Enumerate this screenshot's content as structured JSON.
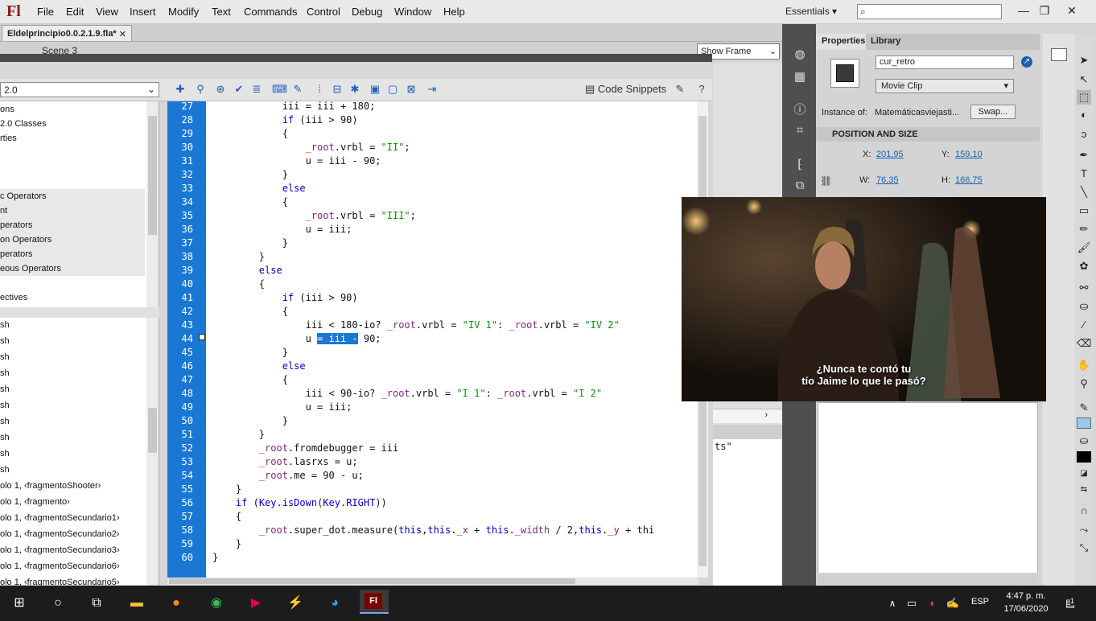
{
  "app": {
    "logo": "Fl",
    "menu": [
      "File",
      "Edit",
      "View",
      "Insert",
      "Modify",
      "Text",
      "Commands",
      "Control",
      "Debug",
      "Window",
      "Help"
    ],
    "workspace": "Essentials",
    "search_placeholder": ""
  },
  "window_controls": {
    "minimize": "—",
    "restore": "❐",
    "close": "✕"
  },
  "document": {
    "tab_label": "Eldelprincipio0.0.2.1.9.fla*",
    "tab_close": "✕",
    "scene": "Scene 3",
    "view_select": "Show Frame"
  },
  "actions": {
    "version": "2.0",
    "code_snippets": "Code Snippets"
  },
  "left_tree": [
    "ons",
    "2.0 Classes",
    "rties",
    "",
    "c Operators",
    "nt",
    "perators",
    "on Operators",
    "perators",
    "eous Operators",
    "",
    "ectives"
  ],
  "left_tree2": [
    "sh",
    "sh",
    "sh",
    "sh",
    "sh",
    "sh",
    "sh",
    "sh",
    "sh",
    "sh",
    "olo 1, ‹fragmentoShooter›",
    "olo 1, ‹fragmento›",
    "olo 1, ‹fragmentoSecundario1›",
    "olo 1, ‹fragmentoSecundario2›",
    "olo 1, ‹fragmentoSecundario3›",
    "olo 1, ‹fragmentoSecundario6›",
    "olo 1, ‹fragmentoSecundario5›"
  ],
  "code": {
    "line_numbers": [
      "27",
      "28",
      "29",
      "30",
      "31",
      "32",
      "33",
      "34",
      "35",
      "36",
      "37",
      "38",
      "39",
      "40",
      "41",
      "42",
      "43",
      "44",
      "45",
      "46",
      "47",
      "48",
      "49",
      "50",
      "51",
      "52",
      "53",
      "54",
      "55",
      "56",
      "57",
      "58",
      "59",
      "60"
    ],
    "lines": [
      "            iii = iii + 180;",
      "            if (iii > 90)",
      "            {",
      "                _root.vrbl = \"II\";",
      "                u = iii - 90;",
      "            }",
      "            else",
      "            {",
      "                _root.vrbl = \"III\";",
      "                u = iii;",
      "            }",
      "        }",
      "        else",
      "        {",
      "            if (iii > 90)",
      "            {",
      "                iii < 180-io? _root.vrbl = \"IV 1\": _root.vrbl = \"IV 2\"",
      "                u = iii - 90;",
      "            }",
      "            else",
      "            {",
      "                iii < 90-io? _root.vrbl = \"I 1\": _root.vrbl = \"I 2\"",
      "                u = iii;",
      "            }",
      "        }",
      "        _root.fromdebugger = iii",
      "        _root.lasrxs = u;",
      "        _root.me = 90 - u;",
      "    }",
      "    if (Key.isDown(Key.RIGHT))",
      "    {",
      "        _root.super_dot.measure(this,this._x + this._width / 2,this._y + thi",
      "    }",
      "}"
    ]
  },
  "output_panel": {
    "text": "ts\""
  },
  "properties": {
    "tabs": [
      "Properties",
      "Library"
    ],
    "instance_name": "cur_retro",
    "type": "Movie Clip",
    "instance_of_label": "Instance of:",
    "instance_of": "Matemáticasviejasti...",
    "swap": "Swap...",
    "section": "POSITION AND SIZE",
    "x_label": "X:",
    "x": "201,95",
    "y_label": "Y:",
    "y": "159,10",
    "w_label": "W:",
    "w": "76,35",
    "h_label": "H:",
    "h": "166,75"
  },
  "video": {
    "subtitle_1": "¿Nunca te contó tu",
    "subtitle_2": "tío Jaime lo que le pasó?"
  },
  "taskbar": {
    "lang": "ESP",
    "time": "4:47 p. m.",
    "date": "17/06/2020",
    "notifications": "1"
  }
}
